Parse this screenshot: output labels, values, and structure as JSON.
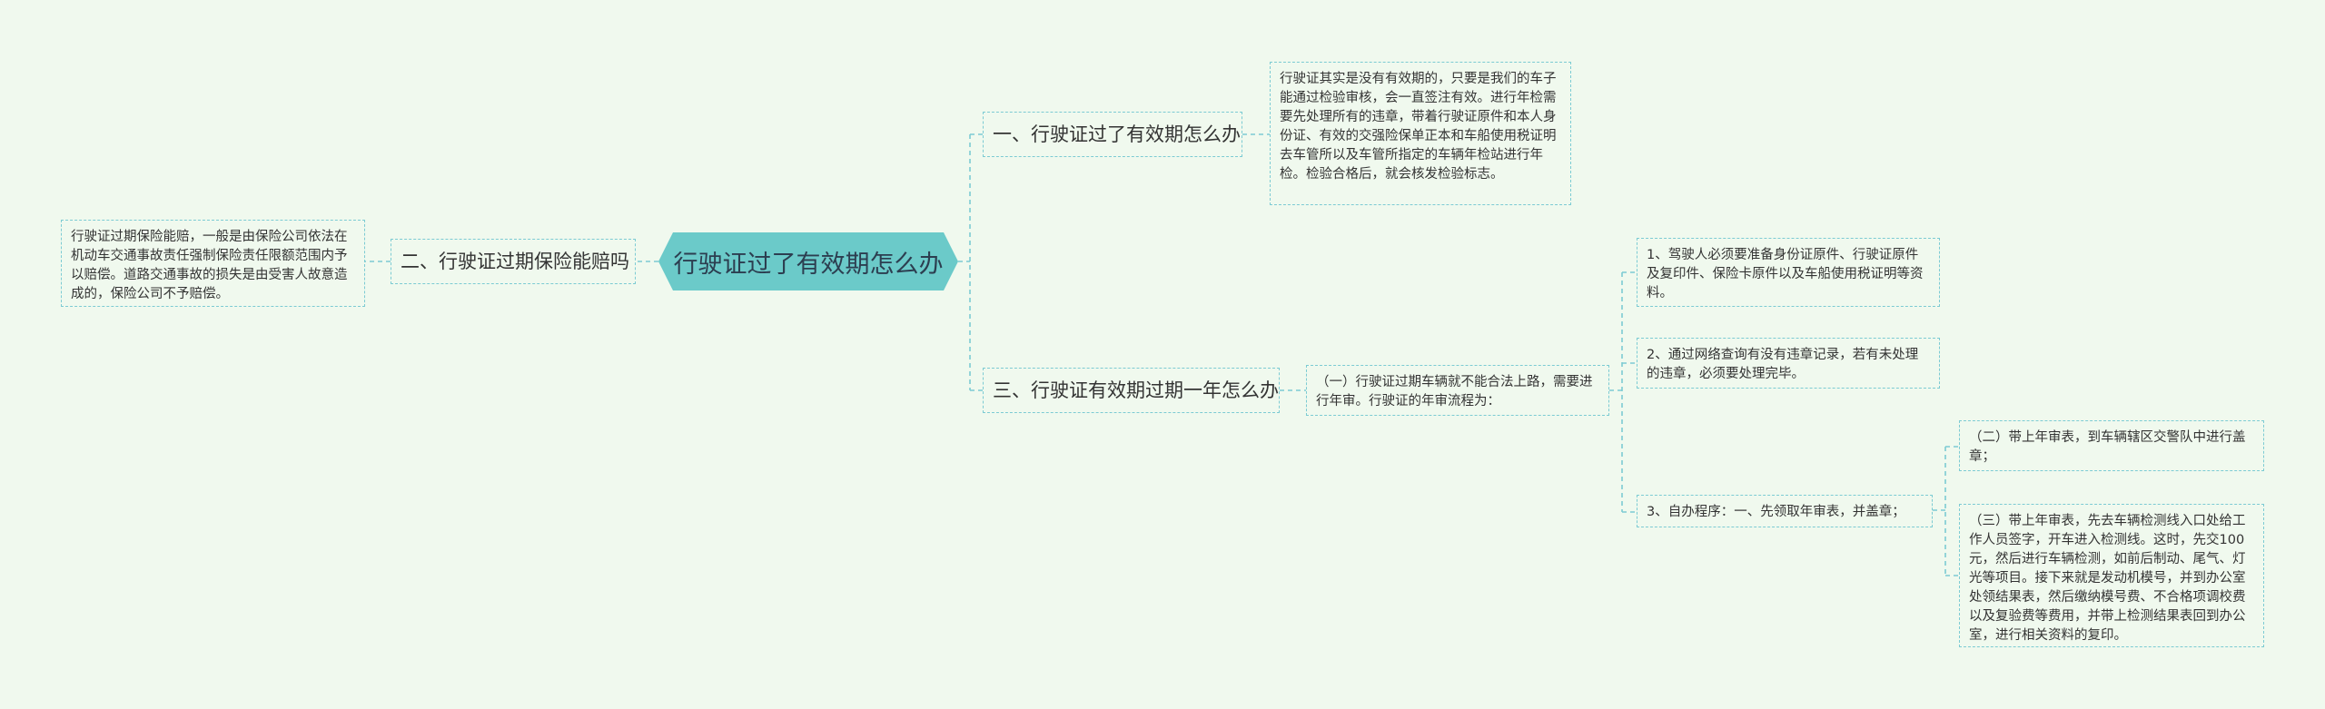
{
  "root": {
    "label": "行驶证过了有效期怎么办"
  },
  "branches": {
    "b1": {
      "label": "一、行驶证过了有效期怎么办"
    },
    "b2": {
      "label": "二、行驶证过期保险能赔吗"
    },
    "b3": {
      "label": "三、行驶证有效期过期一年怎么办"
    }
  },
  "leaves": {
    "b1_detail": "行驶证其实是没有有效期的，只要是我们的车子能通过检验审核，会一直签注有效。进行年检需要先处理所有的违章，带着行驶证原件和本人身份证、有效的交强险保单正本和车船使用税证明去车管所以及车管所指定的车辆年检站进行年检。检验合格后，就会核发检验标志。",
    "b2_detail": "行驶证过期保险能赔，一般是由保险公司依法在机动车交通事故责任强制保险责任限额范围内予以赔偿。道路交通事故的损失是由受害人故意造成的，保险公司不予赔偿。",
    "b3_sub1": "（一）行驶证过期车辆就不能合法上路，需要进行年审。行驶证的年审流程为：",
    "b3_item1": "1、驾驶人必须要准备身份证原件、行驶证原件及复印件、保险卡原件以及车船使用税证明等资料。",
    "b3_item2": "2、通过网络查询有没有违章记录，若有未处理的违章，必须要处理完毕。",
    "b3_item3": "3、自办程序：一、先领取年审表，并盖章；",
    "b3_item3_a": "（二）带上年审表，到车辆辖区交警队中进行盖章；",
    "b3_item3_b": "（三）带上年审表，先去车辆检测线入口处给工作人员签字，开车进入检测线。这时，先交100元，然后进行车辆检测，如前后制动、尾气、灯光等项目。接下来就是发动机模号，并到办公室处领结果表，然后缴纳模号费、不合格项调校费以及复验费等费用，并带上检测结果表回到办公室，进行相关资料的复印。"
  },
  "colors": {
    "root_fill": "#6bcac9",
    "connector": "#7ccbd3",
    "background": "#f0f9ee"
  }
}
